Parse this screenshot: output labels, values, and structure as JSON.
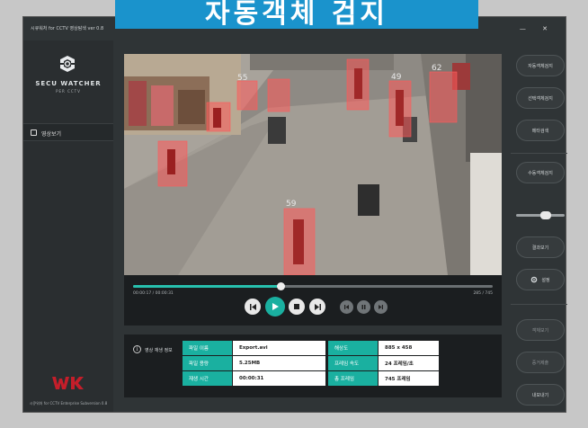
{
  "banner": {
    "text": "자동객체 검지"
  },
  "window": {
    "title": "시큐워처 for CCTV 영상탐색 ver 0.8",
    "minimize_symbol": "—",
    "close_symbol": "✕"
  },
  "sidebar": {
    "brand": "SECU WATCHER",
    "brand_sub": "PER CCTV",
    "menu": [
      {
        "label": "영상보기",
        "icon": "monitor-icon"
      }
    ],
    "footer": "시큐워처 for CCTV Enterprise Subversion 0.8"
  },
  "video": {
    "detections": [
      {
        "id": "",
        "x": 0,
        "y": 0
      },
      {
        "id": "55",
        "x": 0,
        "y": 0
      },
      {
        "id": "49",
        "x": 0,
        "y": 0
      },
      {
        "id": "62",
        "x": 0,
        "y": 0
      },
      {
        "id": "59",
        "x": 0,
        "y": 0
      }
    ]
  },
  "controls": {
    "time_current": "00:00:17 / 00:00:31",
    "time_right": "285 / 745",
    "progress": 0.41
  },
  "info": {
    "title": "영상 재생 정보",
    "rows": [
      {
        "k1": "파일 이름",
        "v1": "Export.avi",
        "k2": "해상도",
        "v2": "885 x 458"
      },
      {
        "k1": "파일 용량",
        "v1": "5.25MB",
        "k2": "프레임 속도",
        "v2": "24 프레임/초"
      },
      {
        "k1": "재생 시간",
        "v1": "00:00:31",
        "k2": "총 프레임",
        "v2": "745 프레임"
      }
    ]
  },
  "right_panel": {
    "buttons": [
      {
        "label": "자동객체검지"
      },
      {
        "label": "선택객체검지"
      },
      {
        "label": "메타검색"
      },
      {
        "label": "수동객체검지"
      },
      {
        "label": "결과보기"
      },
      {
        "label": "설정"
      },
      {
        "label": "객체보기"
      },
      {
        "label": "증거제출"
      },
      {
        "label": "내보내기"
      }
    ],
    "threshold": 0.62
  },
  "colors": {
    "accent": "#1ab0a0",
    "banner": "#1a93cc",
    "detection_box": "#ff5a5a",
    "wk_red": "#c41e2a"
  }
}
